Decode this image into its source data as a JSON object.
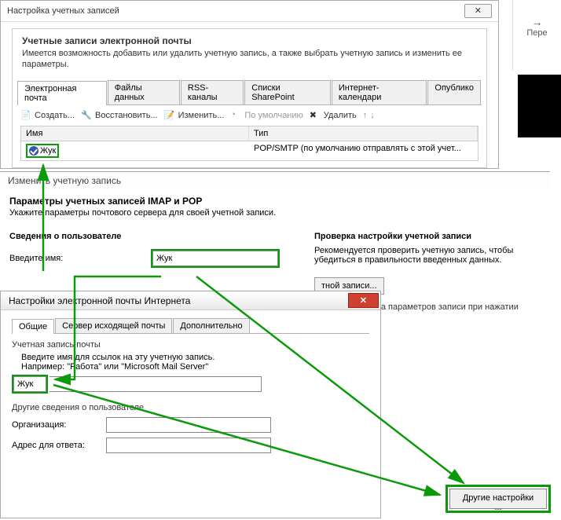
{
  "dlg1": {
    "title": "Настройка учетных записей",
    "close": "✕",
    "heading": "Учетные записи электронной почты",
    "desc": "Имеется возможность добавить или удалить учетную запись, а также выбрать учетную запись и изменить ее параметры.",
    "tabs": [
      "Электронная почта",
      "Файлы данных",
      "RSS-каналы",
      "Списки SharePoint",
      "Интернет-календари",
      "Опублико"
    ],
    "toolbar": {
      "create": "Создать...",
      "repair": "Восстановить...",
      "edit": "Изменить...",
      "default": "По умолчанию",
      "delete": "Удалить"
    },
    "columns": {
      "name": "Имя",
      "type": "Тип"
    },
    "row": {
      "name": "Жук",
      "type": "POP/SMTP (по умолчанию отправлять с этой учет..."
    }
  },
  "dlg2": {
    "title": "Изменить учетную запись",
    "heading": "Параметры учетных записей IMAP и POP",
    "desc": "Укажите параметры почтового сервера для своей учетной записи.",
    "left": {
      "section": "Сведения о пользователе",
      "name_label": "Введите имя:",
      "name_value": "Жук"
    },
    "right": {
      "section": "Проверка настройки учетной записи",
      "desc": "Рекомендуется проверить учетную запись, чтобы убедиться в правильности введенных данных.",
      "btn": "тной записи...",
      "check": "ическая проверка параметров записи при нажатии кнопки"
    }
  },
  "dlg3": {
    "title": "Настройки электронной почты Интернета",
    "tabs": [
      "Общие",
      "Сервер исходящей почты",
      "Дополнительно"
    ],
    "section1": "Учетная запись почты",
    "hint": "Введите имя для ссылок на эту учетную запись.\nНапример: \"Работа\" или \"Microsoft Mail Server\"",
    "value": "Жук",
    "section2": "Другие сведения о пользователе",
    "org_label": "Организация:",
    "reply_label": "Адрес для ответа:"
  },
  "more_btn": "Другие настройки ...",
  "side": "Пере"
}
